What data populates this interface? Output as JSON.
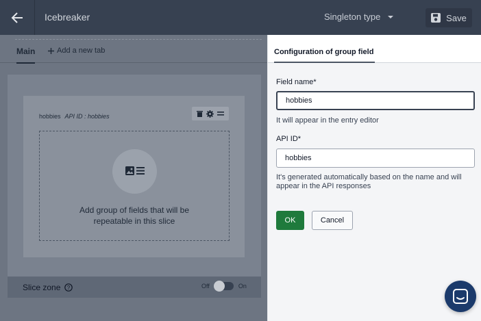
{
  "topbar": {
    "title": "Icebreaker",
    "type_select": "Singleton type",
    "save_label": "Save"
  },
  "editor": {
    "tab_main": "Main",
    "tab_add": "Add a new tab",
    "group": {
      "name": "hobbies",
      "api_id": "API ID : hobbies",
      "drop_text": "Add group of fields that will be\nrepeatable in this slice"
    },
    "slice_zone": {
      "label": "Slice zone",
      "off": "Off",
      "on": "On"
    }
  },
  "panel": {
    "title": "Configuration of group field",
    "field_name_label": "Field name*",
    "field_name_value": "hobbies",
    "field_name_hint": "It will appear in the entry editor",
    "api_id_label": "API ID*",
    "api_id_value": "hobbies",
    "api_id_hint": "It's generated automatically based on the name and will appear in the API responses",
    "ok_label": "OK",
    "cancel_label": "Cancel"
  },
  "colors": {
    "topbar": "#374151",
    "ok_green": "#1f7a3c",
    "chat_blue": "#1b3a6b"
  }
}
